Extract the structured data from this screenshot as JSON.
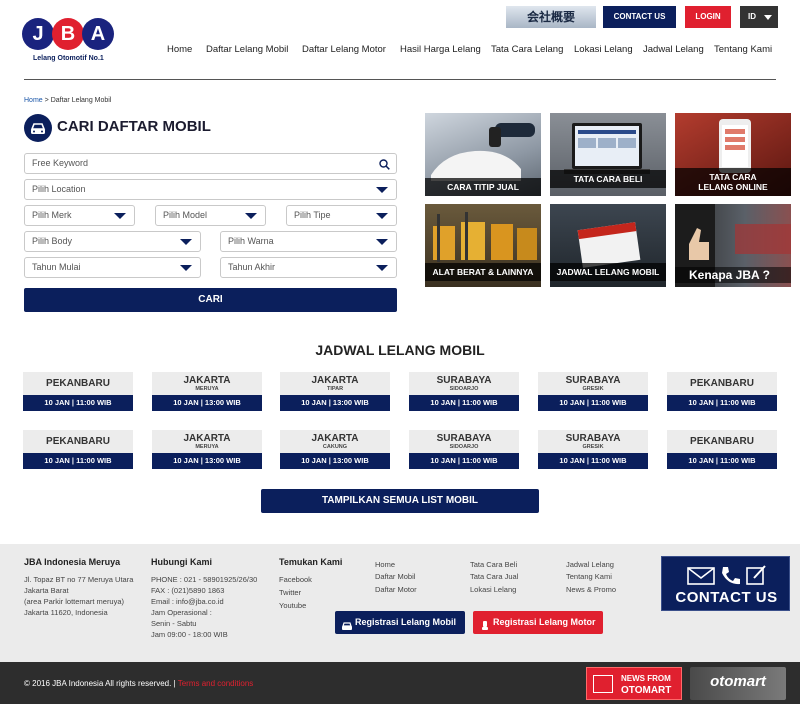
{
  "header": {
    "logo_letters": [
      "J",
      "B",
      "A"
    ],
    "logo_tagline": "Lelang Otomotif No.1",
    "corporate_label": "会社概要",
    "contact_label": "CONTACT US",
    "login_label": "LOGIN",
    "lang_label": "ID",
    "nav": [
      "Home",
      "Daftar Lelang Mobil",
      "Daftar Lelang Motor",
      "Hasil Harga Lelang",
      "Tata Cara Lelang",
      "Lokasi Lelang",
      "Jadwal Lelang",
      "Tentang Kami"
    ]
  },
  "breadcrumb": {
    "home": "Home",
    "current": "Daftar Lelang Mobil"
  },
  "search": {
    "title": "CARI DAFTAR MOBIL",
    "keyword_placeholder": "Free Keyword",
    "location": "Pilih Location",
    "merk": "Pilih Merk",
    "model": "Pilih Model",
    "tipe": "Pilih Tipe",
    "body": "Pilih Body",
    "warna": "Pilih Warna",
    "tahun_mulai": "Tahun Mulai",
    "tahun_akhir": "Tahun Akhir",
    "submit": "CARI"
  },
  "tiles": [
    {
      "label": "CARA TITIP JUAL"
    },
    {
      "label": "TATA CARA BELI"
    },
    {
      "label": "TATA CARA LELANG ONLINE"
    },
    {
      "label": "ALAT BERAT & LAINNYA"
    },
    {
      "label": "JADWAL LELANG MOBIL"
    },
    {
      "label": "Kenapa JBA ?"
    }
  ],
  "schedule": {
    "title": "JADWAL LELANG MOBIL",
    "rows": [
      [
        {
          "city": "PEKANBARU",
          "sub": "",
          "date": "10 JAN | 11:00 WIB"
        },
        {
          "city": "JAKARTA",
          "sub": "MERUYA",
          "date": "10 JAN | 13:00 WIB"
        },
        {
          "city": "JAKARTA",
          "sub": "TIPAR",
          "date": "10 JAN | 13:00 WIB"
        },
        {
          "city": "SURABAYA",
          "sub": "SIDOARJO",
          "date": "10 JAN | 11:00 WIB"
        },
        {
          "city": "SURABAYA",
          "sub": "GRESIK",
          "date": "10 JAN | 11:00 WIB"
        },
        {
          "city": "PEKANBARU",
          "sub": "",
          "date": "10 JAN | 11:00 WIB"
        }
      ],
      [
        {
          "city": "PEKANBARU",
          "sub": "",
          "date": "10 JAN | 11:00 WIB"
        },
        {
          "city": "JAKARTA",
          "sub": "MERUYA",
          "date": "10 JAN | 13:00 WIB"
        },
        {
          "city": "JAKARTA",
          "sub": "CAKUNG",
          "date": "10 JAN | 13:00 WIB"
        },
        {
          "city": "SURABAYA",
          "sub": "SIDOARJO",
          "date": "10 JAN | 11:00 WIB"
        },
        {
          "city": "SURABAYA",
          "sub": "GRESIK",
          "date": "10 JAN | 11:00 WIB"
        },
        {
          "city": "PEKANBARU",
          "sub": "",
          "date": "10 JAN | 11:00 WIB"
        }
      ]
    ],
    "show_all": "TAMPILKAN SEMUA LIST MOBIL"
  },
  "footer": {
    "office_title": "JBA Indonesia Meruya",
    "office_lines": [
      "Jl. Topaz BT no 77 Meruya Utara",
      "Jakarta Barat",
      "(area Parkir lottemart meruya)",
      "Jakarta 11620, Indonesia"
    ],
    "contact_title": "Hubungi Kami",
    "contact_lines": [
      "PHONE : 021 - 58901925/26/30",
      "FAX : (021)5890 1863",
      "Email : info@jba.co.id",
      "Jam Operasional :",
      "Senin - Sabtu",
      "Jam 09:00 - 18:00 WIB"
    ],
    "social_title": "Temukan Kami",
    "social": [
      "Facebook",
      "Twitter",
      "Youtube"
    ],
    "links_col1": [
      "Home",
      "Daftar Mobil",
      "Daftar Motor"
    ],
    "links_col2": [
      "Tata Cara Beli",
      "Tata Cara Jual",
      "Lokasi Lelang"
    ],
    "links_col3": [
      "Jadwal Lelang",
      "Tentang Kami",
      "News & Promo"
    ],
    "reg_mobil": "Registrasi Lelang Mobil",
    "reg_motor": "Registrasi Lelang Motor",
    "contact_banner": "CONTACT US"
  },
  "bottom": {
    "copyright": "© 2016 JBA Indonesia All rights reserved. |",
    "terms": "Terms and conditions",
    "news_line1": "NEWS FROM",
    "news_line2": "OTOMART",
    "otomart_logo": "otomart"
  },
  "colors": {
    "navy": "#0b1f5c",
    "red": "#e0202f",
    "blue_logo": "#1a237e"
  }
}
